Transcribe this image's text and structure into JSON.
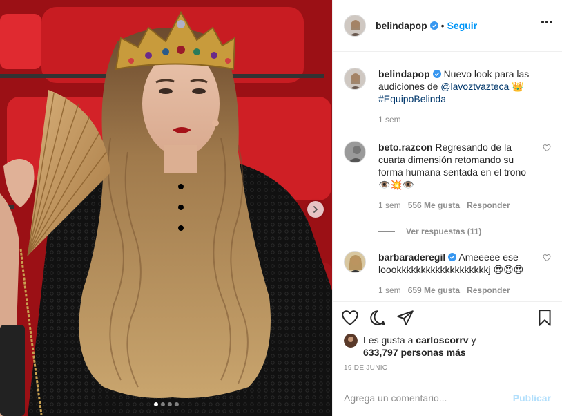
{
  "post": {
    "author": "belindapop",
    "verified": true,
    "follow_label": "Seguir",
    "separator": "•"
  },
  "caption": {
    "username": "belindapop",
    "text_before": "Nuevo look para las audiciones de ",
    "mention": "@lavoztvazteca",
    "emoji": "👑",
    "hashtag": "#EquipoBelinda",
    "time": "1 sem"
  },
  "comments": [
    {
      "username": "beto.razcon",
      "text": "Regresando de la cuarta dimensión retomando su forma humana sentada en el trono 👁️💥👁️",
      "time": "1 sem",
      "likes": "556 Me gusta",
      "reply_label": "Responder",
      "view_replies": "Ver respuestas (11)"
    },
    {
      "username": "barbaraderegil",
      "verified": true,
      "text": "Ameeeee ese loookkkkkkkkkkkkkkkkkkkj 😍😍😍",
      "time": "1 sem",
      "likes": "659 Me gusta",
      "reply_label": "Responder"
    }
  ],
  "likes_summary": {
    "prefix": "Les gusta a ",
    "user": "carloscorrv",
    "connector": " y",
    "count": "633,797 personas más"
  },
  "date": "19 DE JUNIO",
  "comment_box": {
    "placeholder": "Agrega un comentario...",
    "publish_label": "Publicar"
  },
  "carousel": {
    "slide_count": 4,
    "active_index": 0
  },
  "colors": {
    "accent": "#0095f6",
    "verified": "#3897f0",
    "muted": "#8e8e8e",
    "publish_disabled": "#b2dffc"
  }
}
